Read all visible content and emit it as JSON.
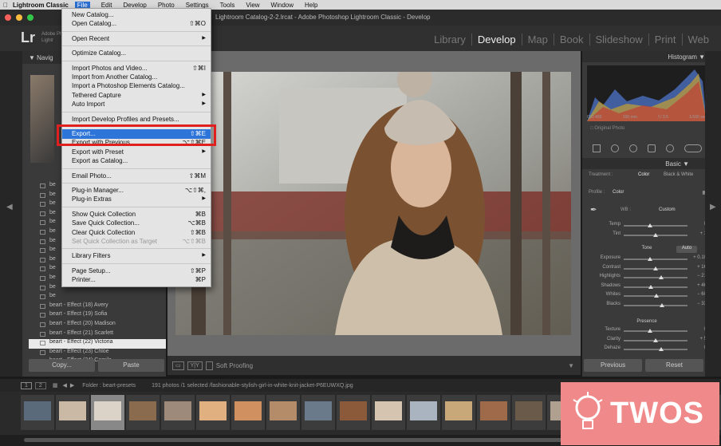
{
  "menubar": {
    "app": "Lightroom Classic",
    "items": [
      "File",
      "Edit",
      "Develop",
      "Photo",
      "Settings",
      "Tools",
      "View",
      "Window",
      "Help"
    ]
  },
  "window_title": "Lightroom Catalog-2-2.lrcat - Adobe Photoshop Lightroom Classic - Develop",
  "identity": {
    "logo": "Lr",
    "line1": "Adobe Ph",
    "line2": "Lightr"
  },
  "modules": [
    "Library",
    "Develop",
    "Map",
    "Book",
    "Slideshow",
    "Print",
    "Web"
  ],
  "active_module": "Develop",
  "left_panel": {
    "navigator_label": "Navig",
    "presets": [
      "be",
      "be",
      "be",
      "be",
      "be",
      "be",
      "be",
      "be",
      "be",
      "be",
      "be",
      "be",
      "be",
      "beart - Effect (18) Avery",
      "beart - Effect (19) Sofia",
      "beart - Effect (20) Madison",
      "beart - Effect (21) Scarlett",
      "beart - Effect (22) Victoria",
      "beart - Effect (23) Chloe",
      "beart - Effect (24) Camila"
    ],
    "selected_preset_index": 17,
    "copy_label": "Copy...",
    "paste_label": "Paste"
  },
  "toolbar": {
    "view_mode": "Y|Y",
    "soft_proofing": "Soft Proofing"
  },
  "right_panel": {
    "histogram_label": "Histogram",
    "hist_info": [
      "ISO 400",
      "100 mm",
      "f / 3.5",
      "1/100 sec"
    ],
    "original_photo": "Original Photo",
    "basic_label": "Basic",
    "treatment_label": "Treatment :",
    "treatment_color": "Color",
    "treatment_bw": "Black & White",
    "profile_label": "Profile :",
    "profile_value": "Color",
    "wb_label": "WB :",
    "wb_value": "Custom",
    "sliders_wb": [
      {
        "label": "Temp",
        "value": "0"
      },
      {
        "label": "Tint",
        "value": "+ 1"
      }
    ],
    "tone_label": "Tone",
    "auto_label": "Auto",
    "sliders_tone": [
      {
        "label": "Exposure",
        "value": "+ 0.10"
      },
      {
        "label": "Contrast",
        "value": "+ 16"
      },
      {
        "label": "Highlights",
        "value": "− 21"
      },
      {
        "label": "Shadows",
        "value": "+ 46"
      },
      {
        "label": "Whites",
        "value": "− 60"
      },
      {
        "label": "Blacks",
        "value": "− 33"
      }
    ],
    "presence_label": "Presence",
    "sliders_presence": [
      {
        "label": "Texture",
        "value": "0"
      },
      {
        "label": "Clarity",
        "value": "+ 5"
      },
      {
        "label": "Dehaze",
        "value": "0"
      }
    ],
    "previous_label": "Previous",
    "reset_label": "Reset"
  },
  "filmstrip": {
    "page1": "1",
    "page2": "2",
    "folder": "Folder : beart-presets",
    "count": "191 photos /1 selected /fashionable-stylish-girl-in-white-knit-jacket-P6EUWXQ.jpg"
  },
  "file_menu": {
    "items": [
      {
        "label": "New Catalog..."
      },
      {
        "label": "Open Catalog...",
        "shortcut": "⇧⌘O"
      },
      {
        "sep": true
      },
      {
        "label": "Open Recent",
        "submenu": true
      },
      {
        "sep": true
      },
      {
        "label": "Optimize Catalog..."
      },
      {
        "sep": true
      },
      {
        "label": "Import Photos and Video...",
        "shortcut": "⇧⌘I"
      },
      {
        "label": "Import from Another Catalog..."
      },
      {
        "label": "Import a Photoshop Elements Catalog..."
      },
      {
        "label": "Tethered Capture",
        "submenu": true
      },
      {
        "label": "Auto Import",
        "submenu": true
      },
      {
        "sep": true
      },
      {
        "label": "Import Develop Profiles and Presets..."
      },
      {
        "sep": true
      },
      {
        "label": "Export...",
        "shortcut": "⇧⌘E",
        "highlight": true
      },
      {
        "label": "Export with Previous",
        "shortcut": "⌥⇧⌘E"
      },
      {
        "label": "Export with Preset",
        "submenu": true
      },
      {
        "label": "Export as Catalog..."
      },
      {
        "sep": true
      },
      {
        "label": "Email Photo...",
        "shortcut": "⇧⌘M"
      },
      {
        "sep": true
      },
      {
        "label": "Plug-in Manager...",
        "shortcut": "⌥⇧⌘,"
      },
      {
        "label": "Plug-in Extras",
        "submenu": true
      },
      {
        "sep": true
      },
      {
        "label": "Show Quick Collection",
        "shortcut": "⌘B"
      },
      {
        "label": "Save Quick Collection...",
        "shortcut": "⌥⌘B"
      },
      {
        "label": "Clear Quick Collection",
        "shortcut": "⇧⌘B"
      },
      {
        "label": "Set Quick Collection as Target",
        "shortcut": "⌥⇧⌘B",
        "disabled": true
      },
      {
        "sep": true
      },
      {
        "label": "Library Filters",
        "submenu": true
      },
      {
        "sep": true
      },
      {
        "label": "Page Setup...",
        "shortcut": "⇧⌘P"
      },
      {
        "label": "Printer...",
        "shortcut": "⌘P"
      }
    ]
  },
  "watermark": {
    "text": "TWOS"
  },
  "colors": {
    "menu_highlight": "#2d75d9",
    "annotation_red": "#e0201e",
    "watermark_bg": "#f08a8a"
  }
}
